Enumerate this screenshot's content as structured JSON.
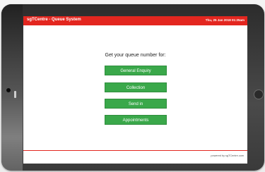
{
  "header": {
    "title": "sgTCentre - Queue System",
    "datetime": "Thu, 25 Jan 2018 01:25am",
    "accent_color": "#e3261f"
  },
  "main": {
    "prompt": "Get your queue number for:",
    "buttons": [
      {
        "label": "General Enquiry"
      },
      {
        "label": "Collection"
      },
      {
        "label": "Send in"
      },
      {
        "label": "Appointments"
      }
    ],
    "button_color": "#3aa84a"
  },
  "footer": {
    "text": "powered by sgTCentre.com"
  }
}
